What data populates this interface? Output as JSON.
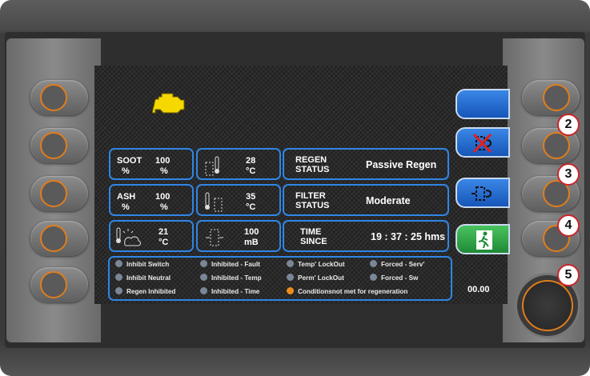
{
  "gauges": {
    "soot": {
      "label": "SOOT",
      "value": "100",
      "unit1": "%",
      "unit2": "%"
    },
    "ash": {
      "label": "ASH",
      "value": "100",
      "unit1": "%",
      "unit2": "%"
    },
    "outside_temp": {
      "value": "21",
      "unit": "°C"
    },
    "temp_in": {
      "value": "28",
      "unit": "°C"
    },
    "temp_out": {
      "value": "35",
      "unit": "°C"
    },
    "pressure": {
      "value": "100",
      "unit": "mB"
    }
  },
  "status": {
    "regen": {
      "label_1": "REGEN",
      "label_2": "STATUS",
      "value": "Passive Regen"
    },
    "filter": {
      "label_1": "FILTER",
      "label_2": "STATUS",
      "value": "Moderate"
    },
    "time": {
      "label_1": "TIME",
      "label_2": "SINCE",
      "value": "19 : 37 : 25 hms"
    }
  },
  "indicators": [
    {
      "label": "Inhibit Switch",
      "active": false
    },
    {
      "label": "Inhibit Neutral",
      "active": false
    },
    {
      "label": "Regen Inhibited",
      "active": false
    },
    {
      "label": "Inhibited - Fault",
      "active": false
    },
    {
      "label": "Inhibited - Temp",
      "active": false
    },
    {
      "label": "Inhibited - Time",
      "active": false
    },
    {
      "label": "Temp' LockOut",
      "active": false
    },
    {
      "label": "Perm' LockOut",
      "active": false
    },
    {
      "label": "Conditionsnot met for regeneration",
      "active": true
    },
    {
      "label": "Forced - Serv'",
      "active": false
    },
    {
      "label": "Forced - Sw",
      "active": false
    }
  ],
  "counter": "00.00",
  "callouts": [
    "2",
    "3",
    "4",
    "5"
  ],
  "icons": {
    "engine": "engine-warning-icon",
    "soft_1": "blank",
    "soft_2": "regen-cancel-icon",
    "soft_3": "regen-start-icon",
    "soft_4": "exit-icon"
  },
  "colors": {
    "accent_blue": "#2f86e6",
    "ring_orange": "#e07d1c",
    "engine_yellow": "#f5d800",
    "exit_green": "#2ea84a",
    "active_dot": "#f08c1c"
  }
}
